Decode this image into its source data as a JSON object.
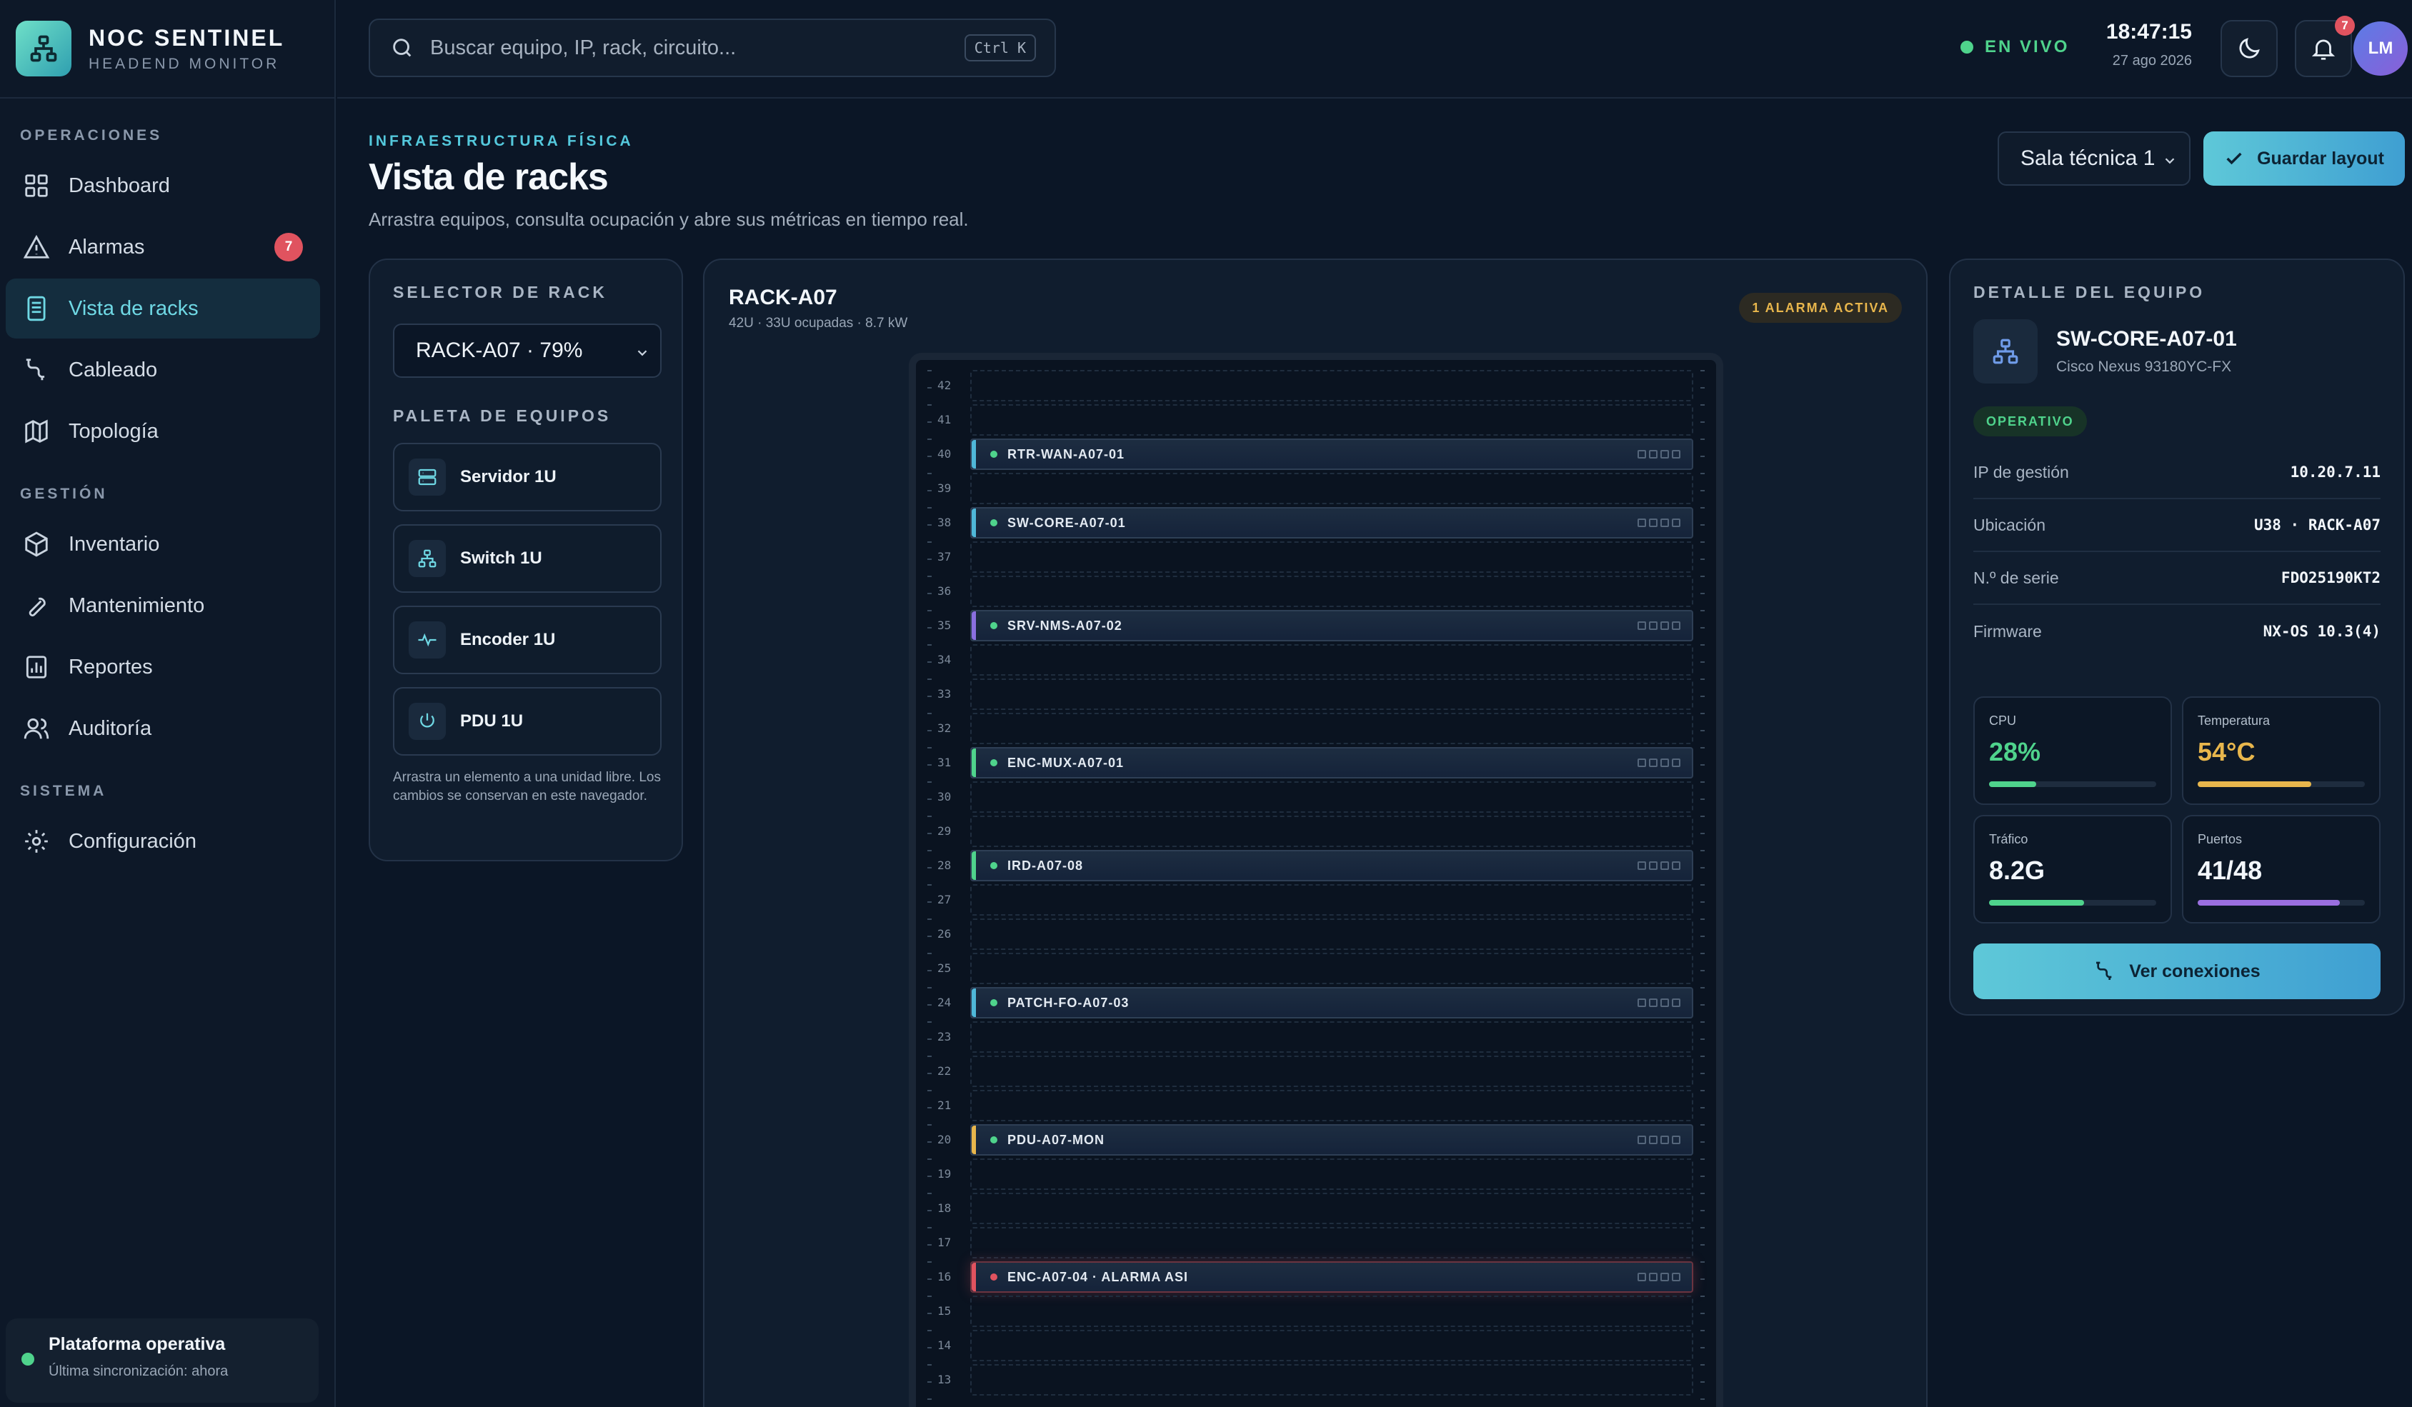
{
  "brand": {
    "title": "NOC SENTINEL",
    "subtitle": "HEADEND MONITOR"
  },
  "sidebar": {
    "sections": [
      {
        "label": "OPERACIONES",
        "items": [
          {
            "label": "Dashboard",
            "icon": "grid-icon"
          },
          {
            "label": "Alarmas",
            "icon": "warning-icon",
            "badge": "7"
          },
          {
            "label": "Vista de racks",
            "icon": "rack-icon",
            "active": true
          },
          {
            "label": "Cableado",
            "icon": "cable-icon"
          },
          {
            "label": "Topología",
            "icon": "map-icon"
          }
        ]
      },
      {
        "label": "GESTIÓN",
        "items": [
          {
            "label": "Inventario",
            "icon": "box-icon"
          },
          {
            "label": "Mantenimiento",
            "icon": "wrench-icon"
          },
          {
            "label": "Reportes",
            "icon": "report-icon"
          },
          {
            "label": "Auditoría",
            "icon": "users-icon"
          }
        ]
      },
      {
        "label": "SISTEMA",
        "items": [
          {
            "label": "Configuración",
            "icon": "gear-icon"
          }
        ]
      }
    ],
    "status": {
      "title": "Plataforma operativa",
      "subtitle": "Última sincronización: ahora"
    }
  },
  "topbar": {
    "search_placeholder": "Buscar equipo, IP, rack, circuito...",
    "shortcut": "Ctrl K",
    "live": "EN VIVO",
    "time": "18:47:15",
    "date": "27 ago 2026",
    "notif_count": "7",
    "avatar": "LM"
  },
  "header": {
    "eyebrow": "INFRAESTRUCTURA FÍSICA",
    "title": "Vista de racks",
    "subtitle": "Arrastra equipos, consulta ocupación y abre sus métricas en tiempo real.",
    "room": "Sala técnica 1",
    "save": "Guardar layout"
  },
  "selector": {
    "label": "SELECTOR DE RACK",
    "value": "RACK-A07 · 79%",
    "palette_label": "PALETA DE EQUIPOS",
    "palette": [
      {
        "label": "Servidor 1U",
        "icon": "server-icon"
      },
      {
        "label": "Switch 1U",
        "icon": "network-icon"
      },
      {
        "label": "Encoder 1U",
        "icon": "pulse-icon"
      },
      {
        "label": "PDU 1U",
        "icon": "power-icon"
      }
    ],
    "hint": "Arrastra un elemento a una unidad libre. Los cambios se conservan en este navegador."
  },
  "rack": {
    "name": "RACK-A07",
    "meta": "42U · 33U ocupadas · 8.7 kW",
    "alarm": "1 ALARMA ACTIVA",
    "units_visible": [
      42,
      41,
      40,
      39,
      38,
      37,
      36,
      35,
      34,
      33,
      32,
      31,
      30,
      29,
      28,
      27,
      26,
      25,
      24,
      23,
      22,
      21,
      20,
      19,
      18,
      17,
      16,
      15,
      14,
      13
    ],
    "devices": [
      {
        "u": 40,
        "label": "RTR-WAN-A07-01",
        "accent": "#4fb7d8",
        "status": "ok"
      },
      {
        "u": 38,
        "label": "SW-CORE-A07-01",
        "accent": "#4fb7d8",
        "status": "ok"
      },
      {
        "u": 35,
        "label": "SRV-NMS-A07-02",
        "accent": "#8a6fe0",
        "status": "ok"
      },
      {
        "u": 31,
        "label": "ENC-MUX-A07-01",
        "accent": "#4fd38c",
        "status": "ok"
      },
      {
        "u": 28,
        "label": "IRD-A07-08",
        "accent": "#4fd38c",
        "status": "ok"
      },
      {
        "u": 24,
        "label": "PATCH-FO-A07-03",
        "accent": "#4fb7d8",
        "status": "ok"
      },
      {
        "u": 20,
        "label": "PDU-A07-MON",
        "accent": "#e8b64c",
        "status": "ok"
      },
      {
        "u": 16,
        "label": "ENC-A07-04 · ALARMA ASI",
        "accent": "#e0535f",
        "status": "alarm"
      }
    ]
  },
  "detail": {
    "label": "DETALLE DEL EQUIPO",
    "name": "SW-CORE-A07-01",
    "model": "Cisco Nexus 93180YC-FX",
    "status": "OPERATIVO",
    "fields": [
      {
        "k": "IP de gestión",
        "v": "10.20.7.11"
      },
      {
        "k": "Ubicación",
        "v": "U38 · RACK-A07"
      },
      {
        "k": "N.º de serie",
        "v": "FDO25190KT2"
      },
      {
        "k": "Firmware",
        "v": "NX-OS 10.3(4)"
      }
    ],
    "metrics": [
      {
        "label": "CPU",
        "value": "28%",
        "fill": 0.28,
        "color": "#4fd38c"
      },
      {
        "label": "Temperatura",
        "value": "54°C",
        "fill": 0.68,
        "color": "#e8b64c"
      },
      {
        "label": "Tráfico",
        "value": "8.2G",
        "fill": 0.57,
        "color": "#4fd38c"
      },
      {
        "label": "Puertos",
        "value": "41/48",
        "fill": 0.85,
        "color": "#9b6fe0"
      }
    ],
    "action": "Ver conexiones"
  }
}
